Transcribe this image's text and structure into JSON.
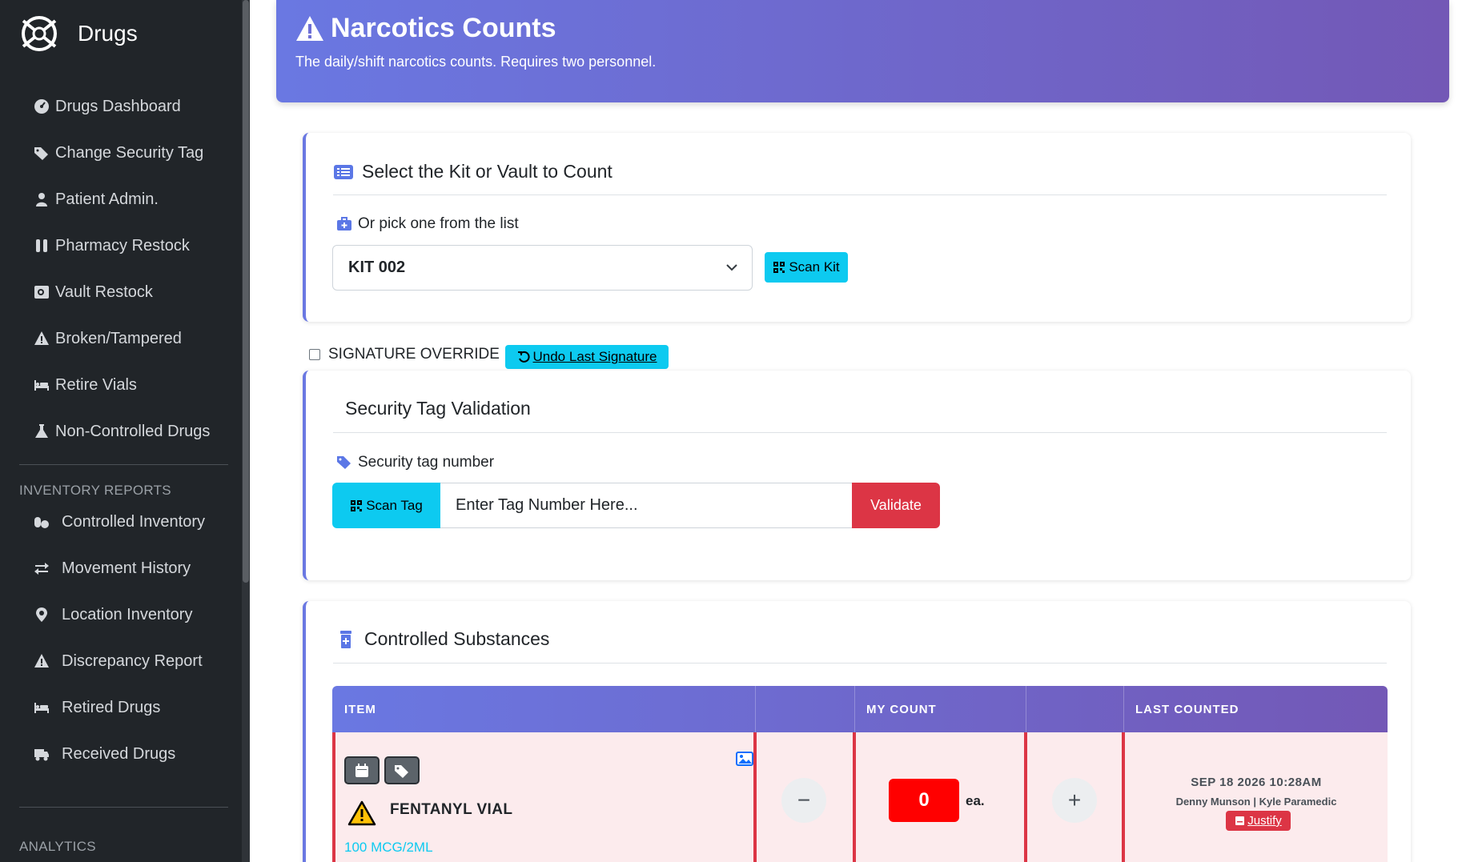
{
  "app": {
    "name": "Drugs"
  },
  "sidebar": {
    "items": [
      {
        "label": "Drugs Dashboard",
        "icon": "gauge-icon"
      },
      {
        "label": "Change Security Tag",
        "icon": "tags-icon"
      },
      {
        "label": "Patient Admin.",
        "icon": "user-nurse-icon"
      },
      {
        "label": "Pharmacy Restock",
        "icon": "vials-icon"
      },
      {
        "label": "Vault Restock",
        "icon": "vault-icon"
      },
      {
        "label": "Broken/Tampered",
        "icon": "warning-icon"
      },
      {
        "label": "Retire Vials",
        "icon": "bed-icon"
      },
      {
        "label": "Non-Controlled Drugs",
        "icon": "flask-icon"
      }
    ],
    "reports_heading": "INVENTORY REPORTS",
    "reports": [
      {
        "label": "Controlled Inventory",
        "icon": "pills-icon"
      },
      {
        "label": "Movement History",
        "icon": "arrows-icon"
      },
      {
        "label": "Location Inventory",
        "icon": "map-pin-icon"
      },
      {
        "label": "Discrepancy Report",
        "icon": "warning-icon"
      },
      {
        "label": "Retired Drugs",
        "icon": "bed-icon"
      },
      {
        "label": "Received Drugs",
        "icon": "truck-icon"
      }
    ],
    "analytics_heading": "ANALYTICS"
  },
  "header": {
    "title": "Narcotics Counts",
    "subtitle": "The daily/shift narcotics counts. Requires two personnel."
  },
  "kit_card": {
    "title": "Select the Kit or Vault to Count",
    "pick_label": "Or pick one from the list",
    "selected_kit": "KIT 002",
    "scan_kit_label": "Scan Kit"
  },
  "signature": {
    "override_label": "SIGNATURE OVERRIDE",
    "override_checked": false,
    "undo_label": "Undo Last Signature"
  },
  "tag_card": {
    "title": "Security Tag Validation",
    "field_label": "Security tag number",
    "scan_label": "Scan Tag",
    "input_placeholder": "Enter Tag Number Here...",
    "validate_label": "Validate"
  },
  "substances": {
    "title": "Controlled Substances",
    "columns": [
      "ITEM",
      "",
      "MY COUNT",
      "",
      "LAST COUNTED"
    ],
    "rows": [
      {
        "name": "FENTANYL VIAL",
        "strength": "100 MCG/2ML",
        "count": "0",
        "unit": "ea.",
        "minus": "−",
        "plus": "+",
        "last_counted_date": "SEP 18 2026 10:28AM",
        "last_counted_by": "Denny Munson | Kyle Paramedic",
        "justify_label": "Justify"
      }
    ]
  },
  "colors": {
    "accent_start": "#6a78e2",
    "accent_end": "#7358b6",
    "info": "#0dcaf0",
    "danger": "#dc3545",
    "sidebar_bg": "#212529"
  }
}
